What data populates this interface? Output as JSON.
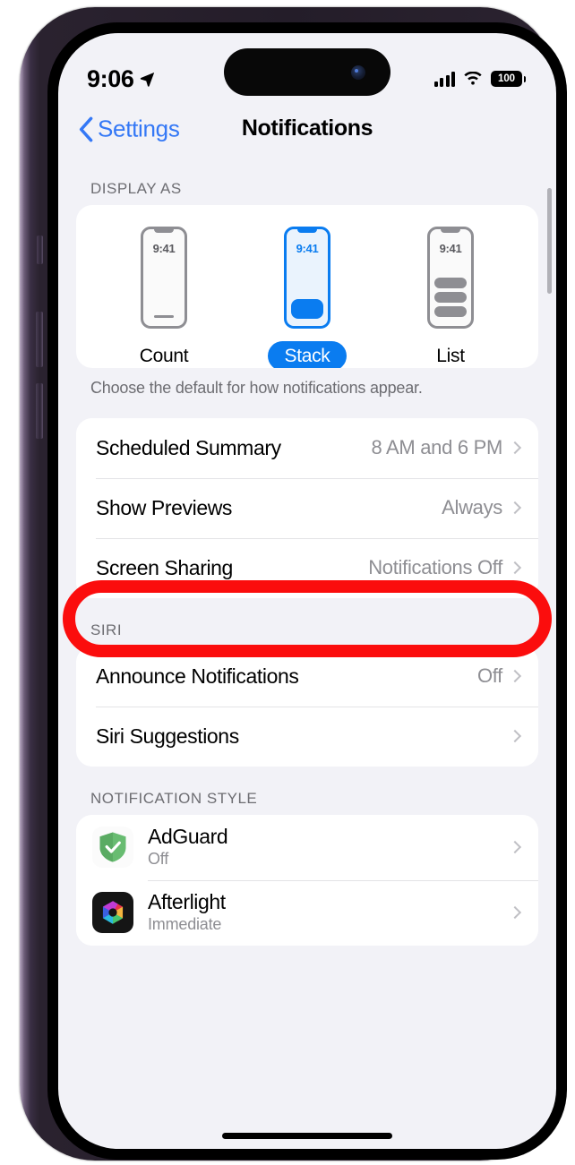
{
  "status_bar": {
    "clock": "9:06",
    "location_icon": "location-arrow-icon",
    "signal_icon": "cellular-signal-icon",
    "wifi_icon": "wifi-icon",
    "battery_percent": "100"
  },
  "nav": {
    "back_label": "Settings",
    "title": "Notifications"
  },
  "display_as": {
    "header": "DISPLAY AS",
    "options": [
      {
        "label": "Count",
        "mini_time": "9:41",
        "selected": false
      },
      {
        "label": "Stack",
        "mini_time": "9:41",
        "selected": true
      },
      {
        "label": "List",
        "mini_time": "9:41",
        "selected": false
      }
    ],
    "footnote": "Choose the default for how notifications appear."
  },
  "general_rows": [
    {
      "label": "Scheduled Summary",
      "value": "8 AM and 6 PM",
      "highlighted": false
    },
    {
      "label": "Show Previews",
      "value": "Always",
      "highlighted": true
    },
    {
      "label": "Screen Sharing",
      "value": "Notifications Off",
      "highlighted": false
    }
  ],
  "siri": {
    "header": "SIRI",
    "rows": [
      {
        "label": "Announce Notifications",
        "value": "Off"
      },
      {
        "label": "Siri Suggestions",
        "value": ""
      }
    ]
  },
  "notification_style": {
    "header": "NOTIFICATION STYLE",
    "apps": [
      {
        "name": "AdGuard",
        "status": "Off",
        "icon": "adguard-shield-icon"
      },
      {
        "name": "Afterlight",
        "status": "Immediate",
        "icon": "afterlight-aperture-icon"
      }
    ]
  },
  "colors": {
    "accent_blue": "#0a7cf0",
    "link_blue": "#3478f6",
    "annotation_red": "#fb0d0d",
    "group_bg": "#f2f2f7",
    "secondary_text": "#8e8e93"
  }
}
